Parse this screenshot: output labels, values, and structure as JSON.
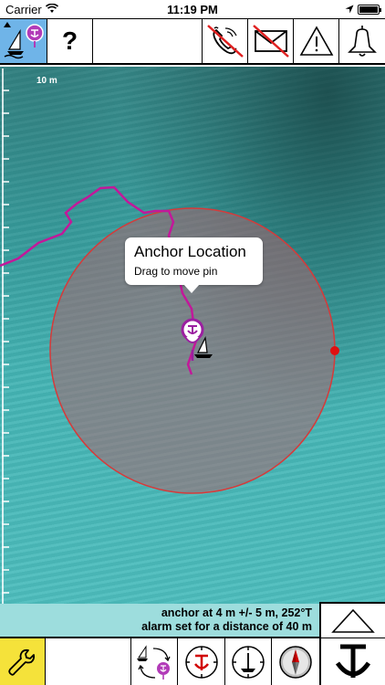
{
  "status_bar": {
    "carrier": "Carrier",
    "time": "11:19 PM"
  },
  "toolbar": {
    "help_label": "?"
  },
  "map": {
    "scale_label": "10 m",
    "callout": {
      "title": "Anchor Location",
      "subtitle": "Drag to move pin"
    }
  },
  "info": {
    "line1": "anchor at 4 m +/- 5 m, 252°T",
    "line2": "alarm set for a distance of 40 m"
  },
  "colors": {
    "track": "#c2189a",
    "alarm_ring": "#d63a3a",
    "mode_active": "#6fb4e8",
    "wrench_bg": "#f5e23a"
  }
}
